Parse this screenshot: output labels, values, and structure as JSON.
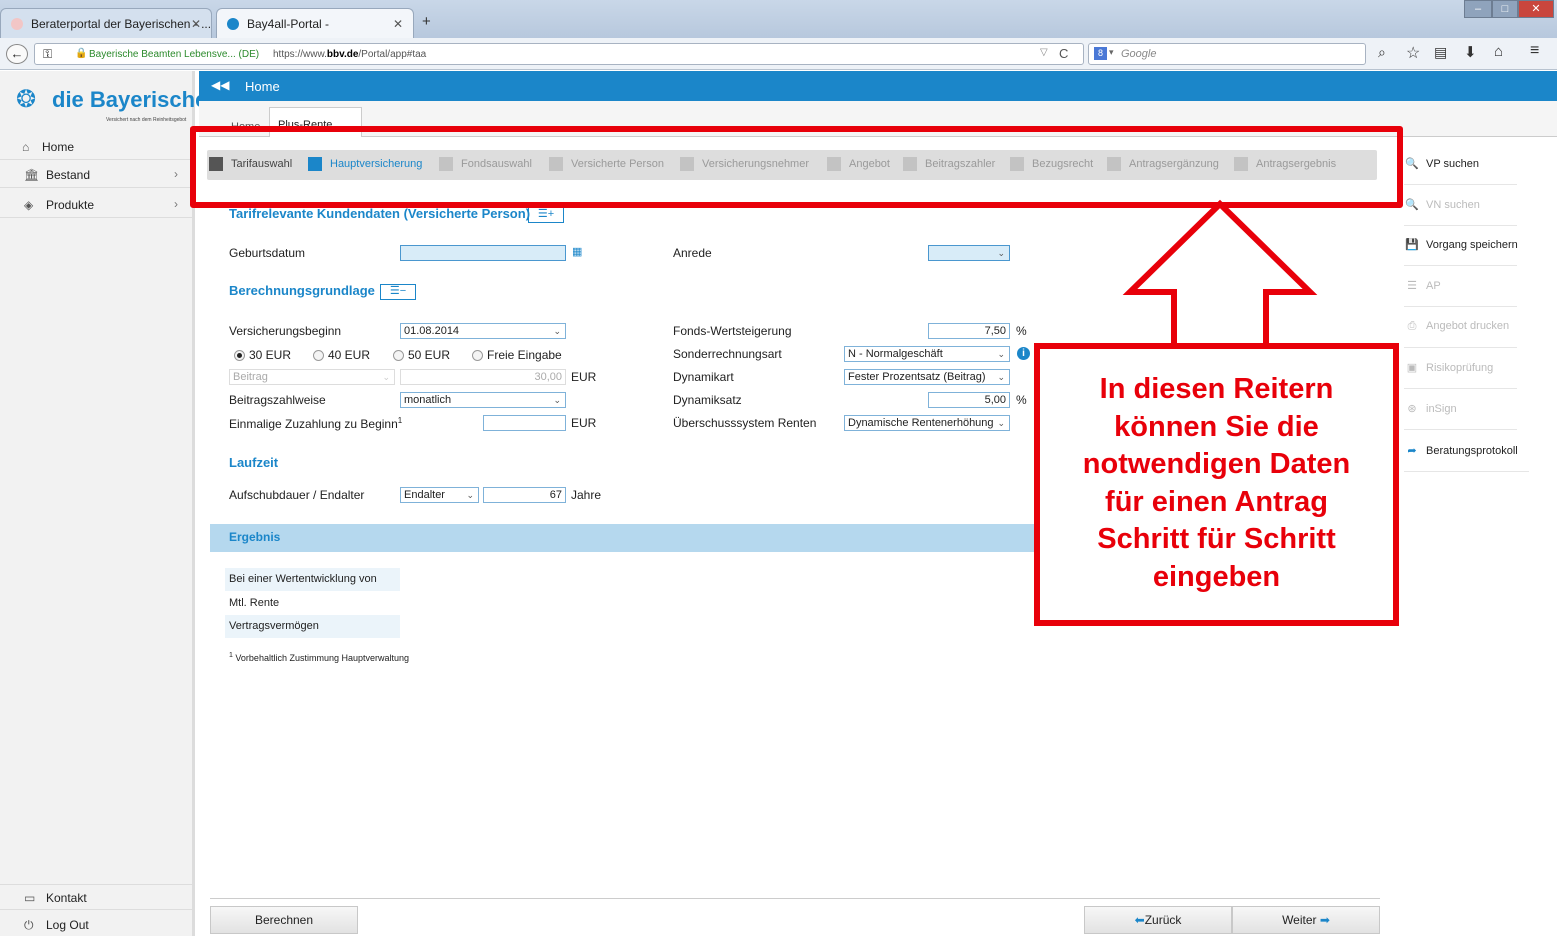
{
  "browser": {
    "tabs": [
      {
        "title": "Beraterportal der Bayerischen - ..."
      },
      {
        "title": "Bay4all-Portal -"
      }
    ],
    "new_tab": "+",
    "site_identity": "Bayerische Beamten Lebensve... (DE)",
    "url_prefix": "https://www.",
    "url_domain": "bbv.de",
    "url_path": "/Portal/app#taa",
    "search_engine": "8",
    "search_placeholder": "Google"
  },
  "app": {
    "logo": "die Bayerische",
    "logo_tagline": "Versichert nach dem Reinheitsgebot",
    "topbar_title": "Home",
    "tabs": [
      {
        "label": "Home"
      },
      {
        "label": "Plus-Rente"
      }
    ],
    "sidebar": [
      {
        "label": "Home",
        "icon": "home-icon"
      },
      {
        "label": "Bestand",
        "icon": "building-icon"
      },
      {
        "label": "Produkte",
        "icon": "layers-icon"
      }
    ],
    "sidebar_bottom": [
      {
        "label": "Kontakt",
        "icon": "contact-icon"
      },
      {
        "label": "Log Out",
        "icon": "power-icon"
      }
    ],
    "steps": [
      {
        "label": "Tarifauswahl",
        "state": "done"
      },
      {
        "label": "Hauptversicherung",
        "state": "active"
      },
      {
        "label": "Fondsauswahl",
        "state": "todo"
      },
      {
        "label": "Versicherte Person",
        "state": "todo"
      },
      {
        "label": "Versicherungsnehmer",
        "state": "todo"
      },
      {
        "label": "Angebot",
        "state": "todo"
      },
      {
        "label": "Beitragszahler",
        "state": "todo"
      },
      {
        "label": "Bezugsrecht",
        "state": "todo"
      },
      {
        "label": "Antragsergänzung",
        "state": "todo"
      },
      {
        "label": "Antragsergebnis",
        "state": "todo"
      }
    ],
    "form": {
      "section_customer": "Tarifrelevante Kundendaten (Versicherte Person)",
      "section_customer_btn": "☰+",
      "geburtsdatum_label": "Geburtsdatum",
      "anrede_label": "Anrede",
      "section_basis": "Berechnungsgrundlage",
      "section_basis_btn": "☰−",
      "versicherungsbeginn_label": "Versicherungsbeginn",
      "versicherungsbeginn_value": "01.08.2014",
      "radio_30": "30 EUR",
      "radio_40": "40 EUR",
      "radio_50": "50 EUR",
      "radio_free": "Freie Eingabe",
      "beitrag_placeholder": "Beitrag",
      "beitrag_value": "30,00",
      "eur": "EUR",
      "beitragszahlweise_label": "Beitragszahlweise",
      "beitragszahlweise_value": "monatlich",
      "zuzahlung_label": "Einmalige Zuzahlung zu Beginn",
      "zuzahlung_sup": "1",
      "fonds_label": "Fonds-Wertsteigerung",
      "fonds_value": "7,50",
      "percent": "%",
      "sonderrechnungsart_label": "Sonderrechnungsart",
      "sonderrechnungsart_value": "N - Normalgeschäft",
      "dynamikart_label": "Dynamikart",
      "dynamikart_value": "Fester Prozentsatz (Beitrag)",
      "dynamiksatz_label": "Dynamiksatz",
      "dynamiksatz_value": "5,00",
      "ueberschuss_label": "Überschusssystem Renten",
      "ueberschuss_value": "Dynamische Rentenerhöhung",
      "section_laufzeit": "Laufzeit",
      "aufschub_label": "Aufschubdauer / Endalter",
      "aufschub_select": "Endalter",
      "aufschub_value": "67",
      "jahre": "Jahre"
    },
    "result": {
      "title": "Ergebnis",
      "rows": [
        "Bei einer Wertentwicklung von",
        "Mtl. Rente",
        "Vertragsvermögen"
      ],
      "footnote_num": "1",
      "footnote": "Vorbehaltlich Zustimmung Hauptverwaltung"
    },
    "actions": [
      {
        "label": "VP suchen",
        "icon": "search-icon",
        "enabled": true
      },
      {
        "label": "VN suchen",
        "icon": "search-icon",
        "enabled": false
      },
      {
        "label": "Vorgang speichern",
        "icon": "save-icon",
        "enabled": true
      },
      {
        "label": "AP",
        "icon": "list-icon",
        "enabled": false
      },
      {
        "label": "Angebot drucken",
        "icon": "print-icon",
        "enabled": false
      },
      {
        "label": "Risikoprüfung",
        "icon": "briefcase-icon",
        "enabled": false
      },
      {
        "label": "inSign",
        "icon": "globe-icon",
        "enabled": false
      },
      {
        "label": "Beratungsprotokoll",
        "icon": "share-icon",
        "enabled": true
      }
    ],
    "buttons": {
      "berechnen": "Berechnen",
      "zurueck": "Zurück",
      "weiter": "Weiter"
    }
  },
  "callout": {
    "line1": "In diesen Reitern",
    "line2": "können Sie die",
    "line3": "notwendigen Daten",
    "line4": "für einen Antrag",
    "line5": "Schritt für Schritt",
    "line6": "eingeben"
  },
  "colors": {
    "accent": "#1b86c9",
    "highlight": "#e8000a"
  }
}
